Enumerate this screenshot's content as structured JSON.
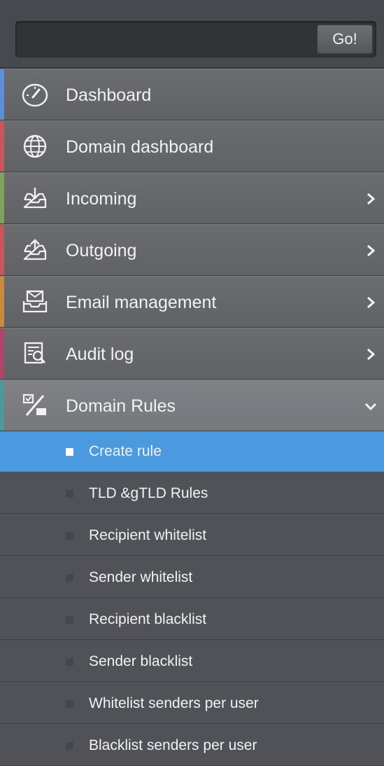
{
  "search": {
    "placeholder": "",
    "value": "",
    "button_label": "Go!"
  },
  "menu": [
    {
      "label": "Dashboard",
      "icon": "gauge-icon",
      "accent": "#5b8fd8",
      "has_submenu": false
    },
    {
      "label": "Domain dashboard",
      "icon": "globe-icon",
      "accent": "#c9575a",
      "has_submenu": false
    },
    {
      "label": "Incoming",
      "icon": "inbox-download-icon",
      "accent": "#7ea35a",
      "has_submenu": true
    },
    {
      "label": "Outgoing",
      "icon": "outbox-upload-icon",
      "accent": "#c9575a",
      "has_submenu": true
    },
    {
      "label": "Email management",
      "icon": "envelope-tray-icon",
      "accent": "#c98a3c",
      "has_submenu": true
    },
    {
      "label": "Audit log",
      "icon": "log-search-icon",
      "accent": "#b0456a",
      "has_submenu": true
    },
    {
      "label": "Domain Rules",
      "icon": "rules-percent-icon",
      "accent": "#4a9a9a",
      "has_submenu": true,
      "expanded": true
    }
  ],
  "submenu": [
    {
      "label": "Create rule",
      "selected": true
    },
    {
      "label": "TLD &gTLD Rules"
    },
    {
      "label": "Recipient whitelist"
    },
    {
      "label": "Sender whitelist"
    },
    {
      "label": "Recipient blacklist"
    },
    {
      "label": "Sender blacklist"
    },
    {
      "label": "Whitelist senders per user"
    },
    {
      "label": "Blacklist senders per user"
    }
  ]
}
